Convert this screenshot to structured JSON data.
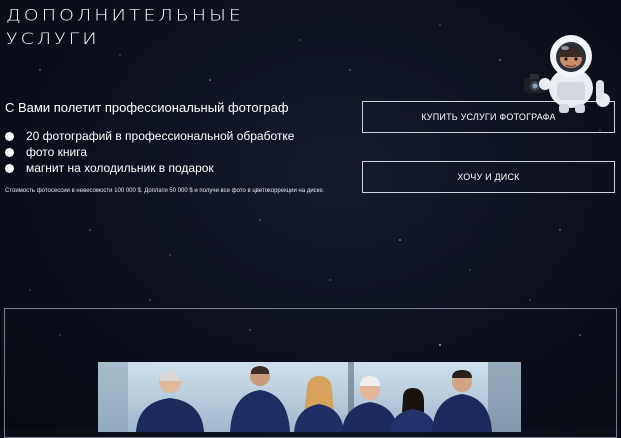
{
  "section": {
    "title_line1": "ДОПОЛНИТЕЛЬНЫЕ",
    "title_line2": "УСЛУГИ"
  },
  "intro": "С Вами полетит профессиональный фотограф",
  "services": [
    "20 фотографий в профессиональной обработке",
    "фото книга",
    "магнит на холодильник в подарок"
  ],
  "note": "Стоимость фотосессии в невесомости 100 000 $. Доплати 50 000 $ и получи все фото в цветокоррекции на диске.",
  "buttons": {
    "buy": "КУПИТЬ УСЛУГИ ФОТОГРАФА",
    "disk": "ХОЧУ И ДИСК"
  },
  "colors": {
    "background": "#0c101c",
    "border": "#cfd3dc"
  },
  "icons": [
    "astronaut-photographer-icon",
    "bullet-icon"
  ]
}
